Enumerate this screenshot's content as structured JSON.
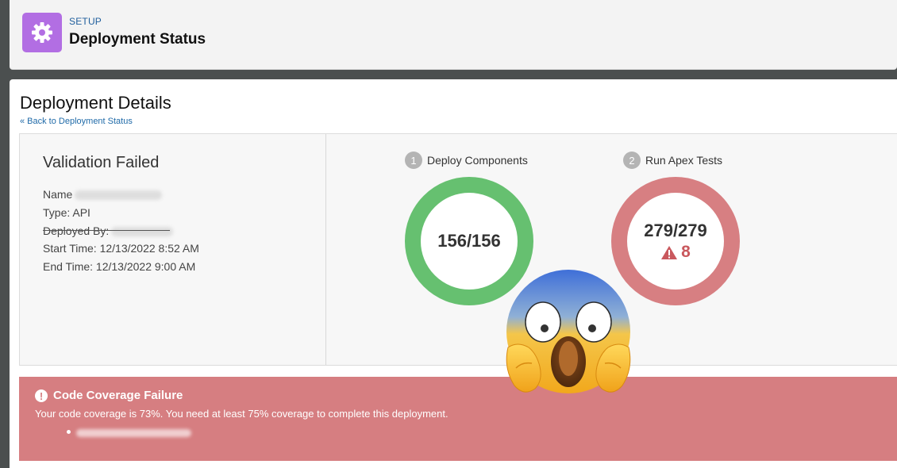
{
  "header": {
    "eyebrow": "SETUP",
    "title": "Deployment Status",
    "icon": "gear-icon"
  },
  "page": {
    "title": "Deployment Details",
    "back_link": "« Back to Deployment Status"
  },
  "details": {
    "status": "Validation Failed",
    "name_label": "Name",
    "type_line": "Type: API",
    "deployed_by_label": "Deployed By:",
    "start_time": "Start Time: 12/13/2022 8:52 AM",
    "end_time": "End Time: 12/13/2022 9:00 AM"
  },
  "steps": [
    {
      "number": "1",
      "label": "Deploy Components",
      "value": "156/156",
      "color": "#66c070"
    },
    {
      "number": "2",
      "label": "Run Apex Tests",
      "value": "279/279",
      "warnings": "8",
      "color": "#d77f82"
    }
  ],
  "error": {
    "title": "Code Coverage Failure",
    "message": "Your code coverage is 73%. You need at least 75% coverage to complete this deployment.",
    "icon": "exclamation-circle-icon",
    "color": "#d67e81"
  },
  "overlay": {
    "icon": "screaming-face-emoji-icon"
  }
}
